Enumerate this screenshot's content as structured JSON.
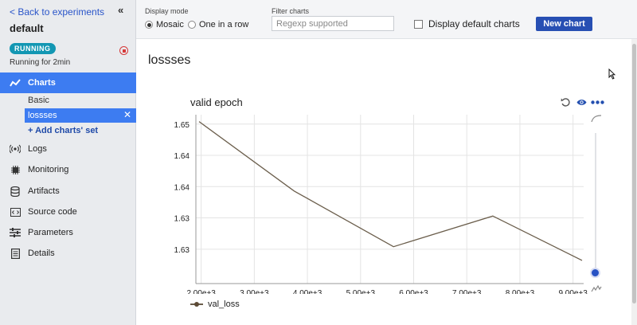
{
  "sidebar": {
    "back_label": "< Back to experiments",
    "experiment_name": "default",
    "status_badge": "RUNNING",
    "running_text": "Running for 2min",
    "nav": [
      {
        "label": "Charts",
        "icon": "line-chart-icon",
        "active": true
      },
      {
        "label": "Logs",
        "icon": "broadcast-icon"
      },
      {
        "label": "Monitoring",
        "icon": "chip-icon"
      },
      {
        "label": "Artifacts",
        "icon": "database-icon"
      },
      {
        "label": "Source code",
        "icon": "code-icon"
      },
      {
        "label": "Parameters",
        "icon": "sliders-icon"
      },
      {
        "label": "Details",
        "icon": "document-icon"
      }
    ],
    "chart_sets": [
      {
        "label": "Basic"
      },
      {
        "label": "lossses",
        "selected": true
      }
    ],
    "add_set_label": "+ Add charts' set"
  },
  "toolbar": {
    "display_mode_label": "Display mode",
    "mode_options": [
      "Mosaic",
      "One in a row"
    ],
    "mode_selected": "Mosaic",
    "filter_label": "Filter charts",
    "filter_placeholder": "Regexp supported",
    "filter_value": "",
    "default_charts_label": "Display default charts",
    "new_chart_label": "New chart"
  },
  "main": {
    "set_title": "lossses",
    "chart_title": "valid epoch"
  },
  "colors": {
    "accent": "#3d7cf1",
    "primary_button": "#274fb3",
    "status": "#1397b3",
    "series": "#6b5e4c"
  },
  "chart_data": {
    "type": "line",
    "title": "valid epoch",
    "xlabel": "",
    "ylabel": "",
    "x_ticks": [
      "2.00e+3",
      "3.00e+3",
      "4.00e+3",
      "5.00e+3",
      "6.00e+3",
      "7.00e+3",
      "8.00e+3",
      "9.00e+3"
    ],
    "y_ticks": [
      "1.65",
      "1.64",
      "1.64",
      "1.63",
      "1.63"
    ],
    "xlim": [
      1900,
      9200
    ],
    "ylim": [
      1.6245,
      1.6515
    ],
    "grid": true,
    "legend": "bottom-left",
    "series": [
      {
        "name": "val_loss",
        "x": [
          1960,
          3750,
          5620,
          7490,
          9170
        ],
        "y": [
          1.6504,
          1.6393,
          1.6304,
          1.6353,
          1.6282
        ]
      }
    ]
  }
}
